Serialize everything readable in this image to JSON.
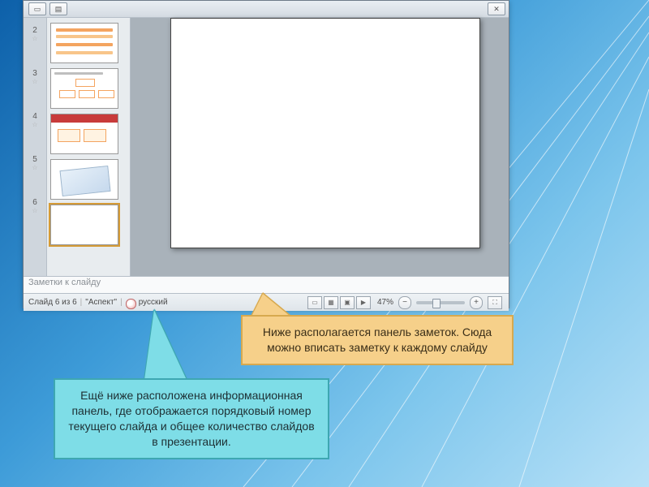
{
  "app": {
    "thumbs": [
      {
        "num": "2"
      },
      {
        "num": "3"
      },
      {
        "num": "4"
      },
      {
        "num": "5"
      },
      {
        "num": "6"
      }
    ],
    "notes_placeholder": "Заметки к слайду",
    "status": {
      "slide_info": "Слайд 6 из 6",
      "theme": "\"Аспект\"",
      "language": "русский",
      "zoom": "47%"
    }
  },
  "callouts": {
    "orange": "Ниже располагается панель заметок. Сюда можно вписать заметку к каждому слайду",
    "cyan": "Ещё ниже расположена информационная панель, где отображается порядковый номер текущего слайда и общее количество слайдов в презентации."
  }
}
